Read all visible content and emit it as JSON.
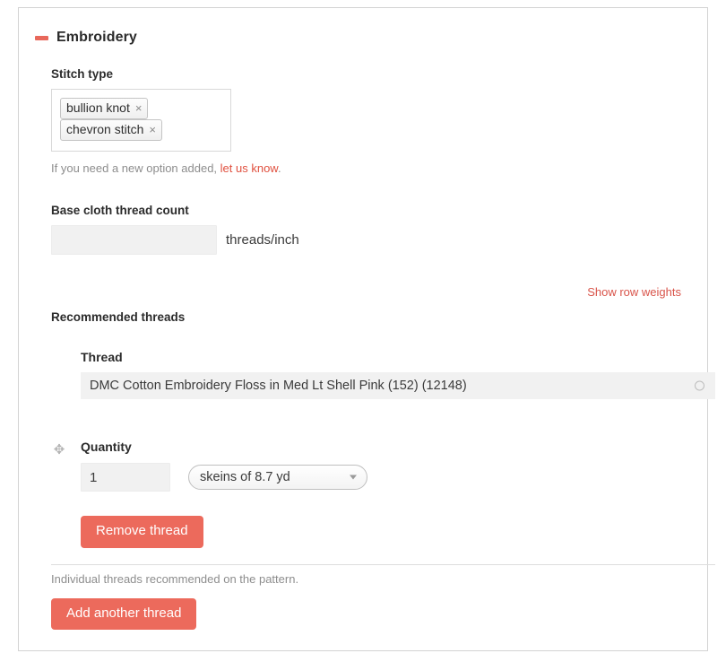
{
  "section": {
    "title": "Embroidery",
    "collapse_icon": "minus-icon",
    "expanded": true
  },
  "stitch_type": {
    "label": "Stitch type",
    "chips": [
      {
        "label": "bullion knot",
        "remove_glyph": "×"
      },
      {
        "label": "chevron stitch",
        "remove_glyph": "×"
      }
    ],
    "description_prefix": "If you need a new option added, ",
    "description_link": "let us know",
    "description_suffix": "."
  },
  "base_cloth_thread_count": {
    "label": "Base cloth thread count",
    "value": "",
    "placeholder": "",
    "suffix": "threads/inch"
  },
  "row_weights": {
    "link_label": "Show row weights"
  },
  "recommended_threads": {
    "label": "Recommended threads",
    "column_header": "Thread",
    "rows": [
      {
        "thread_value": "DMC Cotton Embroidery Floss in Med Lt Shell Pink (152) (12148)",
        "throbber_icon": "circle-throbber-icon",
        "drag_handle_icon": "drag-move-icon",
        "drag_handle_glyph": "✥",
        "quantity_label": "Quantity",
        "quantity_value": "1",
        "unit_selected": "skeins of 8.7 yd",
        "remove_button_label": "Remove thread"
      }
    ],
    "footer_description": "Individual threads recommended on the pattern.",
    "add_button_label": "Add another thread"
  },
  "colors": {
    "accent_red": "#ec6a5c",
    "link_red": "#d9544a",
    "text_dark": "#2b2b2b",
    "muted": "#8d8d8d",
    "field_bg": "#f1f1f1"
  }
}
